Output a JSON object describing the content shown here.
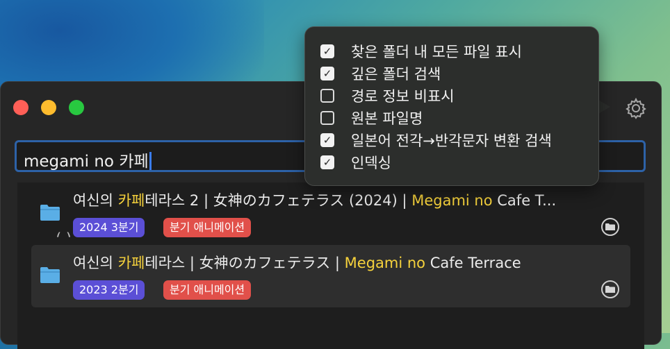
{
  "search": {
    "value": "megami no 카페"
  },
  "settings_menu": {
    "options": [
      {
        "label": "찾은 폴더 내 모든 파일 표시",
        "checked": true
      },
      {
        "label": "깊은 폴더 검색",
        "checked": true
      },
      {
        "label": "경로 정보 비표시",
        "checked": false
      },
      {
        "label": "원본 파일명",
        "checked": false
      },
      {
        "label": "일본어 전각→반각문자 변환 검색",
        "checked": true
      },
      {
        "label": "인덱싱",
        "checked": true
      }
    ]
  },
  "results": [
    {
      "title_parts": [
        "여신의 ",
        "카페",
        "테라스 2 | 女神のカフェテラス (2024) | ",
        "Megami no",
        " Cafe T..."
      ],
      "tags": [
        "2024 3분기",
        "분기 애니메이션"
      ]
    },
    {
      "title_parts": [
        "여신의 ",
        "카페",
        "테라스 | 女神のカフェテラス | ",
        "Megami no",
        " Cafe Terrace"
      ],
      "tags": [
        "2023 2분기",
        "분기 애니메이션"
      ]
    }
  ],
  "partial_row": {
    "text": "(                                         )"
  },
  "icons": {
    "folder": "folder-icon",
    "gear": "gear-icon",
    "open": "open-folder-icon",
    "check": "checkmark-icon"
  },
  "colors": {
    "highlight": "#f6d23c",
    "season_tag": "#5b4fd6",
    "anime_tag": "#e1504a",
    "search_border": "#2d62a8",
    "folder": "#5aaee6"
  }
}
